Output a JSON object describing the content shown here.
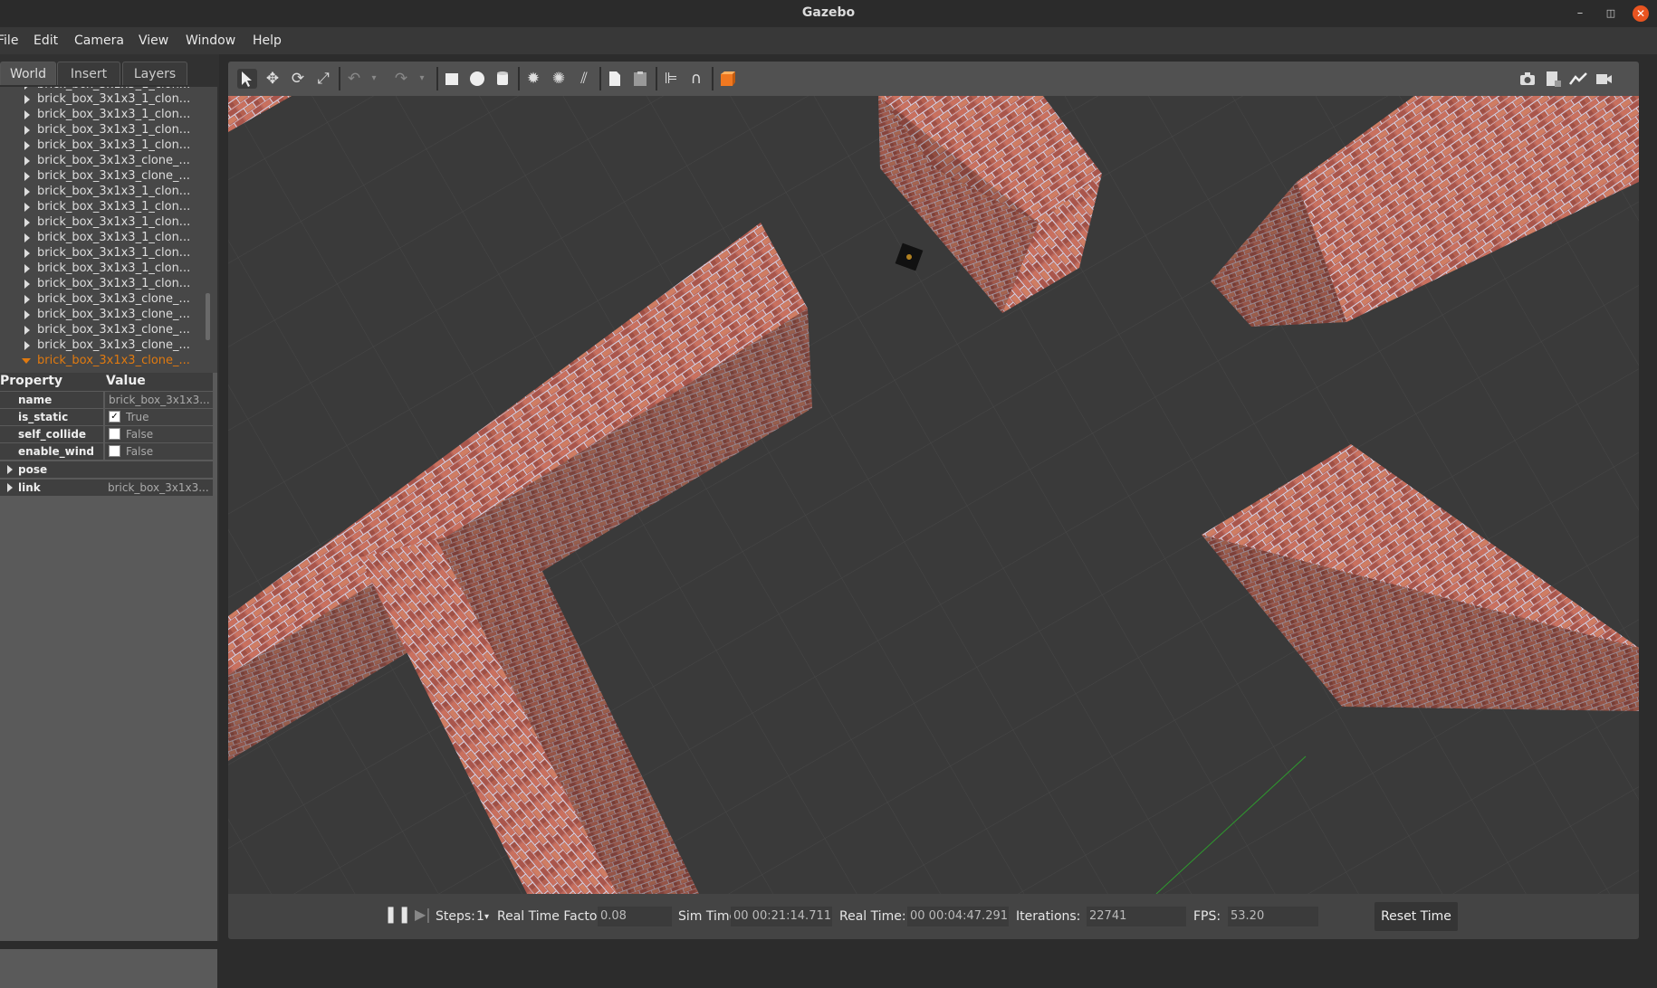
{
  "window": {
    "title": "Gazebo"
  },
  "menu": [
    "File",
    "Edit",
    "Camera",
    "View",
    "Window",
    "Help"
  ],
  "tabs": [
    "World",
    "Insert",
    "Layers"
  ],
  "tree": {
    "items": [
      "brick_box_3x1x3_1_clon...",
      "brick_box_3x1x3_1_clon...",
      "brick_box_3x1x3_1_clon...",
      "brick_box_3x1x3_1_clon...",
      "brick_box_3x1x3_clone_...",
      "brick_box_3x1x3_clone_...",
      "brick_box_3x1x3_1_clon...",
      "brick_box_3x1x3_1_clon...",
      "brick_box_3x1x3_1_clon...",
      "brick_box_3x1x3_1_clon...",
      "brick_box_3x1x3_1_clon...",
      "brick_box_3x1x3_1_clon...",
      "brick_box_3x1x3_1_clon...",
      "brick_box_3x1x3_clone_...",
      "brick_box_3x1x3_clone_...",
      "brick_box_3x1x3_clone_...",
      "brick_box_3x1x3_clone_..."
    ],
    "selected": "brick_box_3x1x3_clone_..."
  },
  "properties": {
    "col_property": "Property",
    "col_value": "Value",
    "name_key": "name",
    "name_val": "brick_box_3x1x3...",
    "static_key": "is_static",
    "static_val": "True",
    "collide_key": "self_collide",
    "collide_val": "False",
    "wind_key": "enable_wind",
    "wind_val": "False",
    "pose_key": "pose",
    "link_key": "link",
    "link_val": "brick_box_3x1x3..."
  },
  "status": {
    "steps_label": "Steps:",
    "steps_value": "1",
    "rtf_label": "Real Time Factor:",
    "rtf_value": "0.08",
    "sim_label": "Sim Time:",
    "sim_value": "00 00:21:14.711",
    "real_label": "Real Time:",
    "real_value": "00 00:04:47.291",
    "iter_label": "Iterations:",
    "iter_value": "22741",
    "fps_label": "FPS:",
    "fps_value": "53.20",
    "reset_label": "Reset Time"
  },
  "icons": [
    "select-icon",
    "translate-icon",
    "rotate-icon",
    "scale-icon",
    "undo-icon",
    "redo-icon",
    "box-icon",
    "sphere-icon",
    "cylinder-icon",
    "point-light-icon",
    "spot-light-icon",
    "directional-light-icon",
    "copy-icon",
    "paste-icon",
    "align-icon",
    "snap-icon",
    "view-angle-icon",
    "screenshot-icon",
    "log-icon",
    "plot-icon",
    "record-icon",
    "pause-icon",
    "step-icon"
  ]
}
